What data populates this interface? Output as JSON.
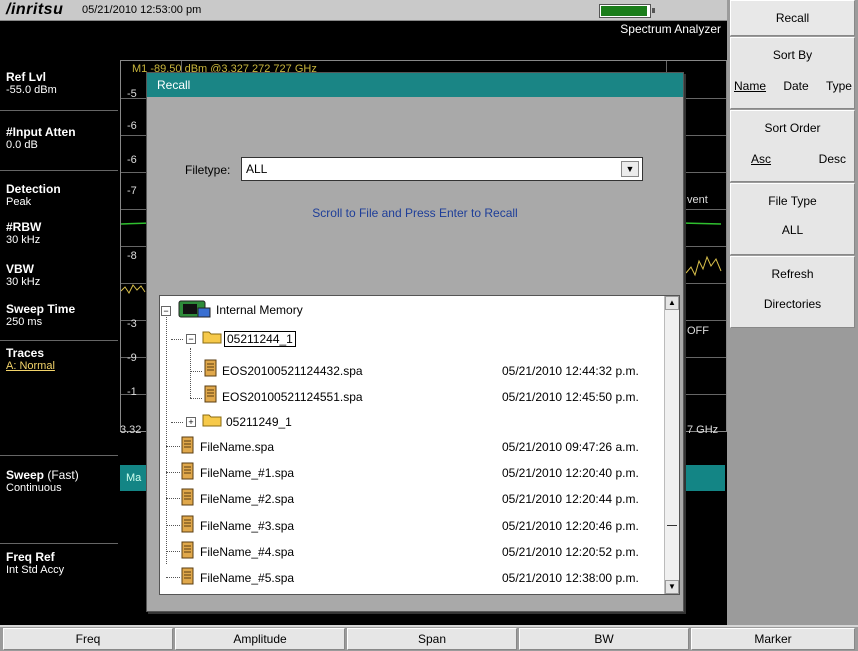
{
  "status": {
    "logo": "/inritsu",
    "datetime": "05/21/2010 12:53:00 pm",
    "battery_level": 0.95,
    "mode": "Spectrum Analyzer"
  },
  "params": {
    "ref_lvl_label": "Ref Lvl",
    "ref_lvl_value": "-55.0 dBm",
    "input_atten_label": "#Input Atten",
    "input_atten_value": "0.0 dB",
    "detection_label": "Detection",
    "detection_value": "Peak",
    "rbw_label": "#RBW",
    "rbw_value": "30 kHz",
    "vbw_label": "VBW",
    "vbw_value": "30 kHz",
    "sweep_time_label": "Sweep Time",
    "sweep_time_value": "250 ms",
    "traces_label": "Traces",
    "traces_value": "A: Normal",
    "sweep_label": "Sweep",
    "sweep_suffix": "(Fast)",
    "sweep_value": "Continuous",
    "freq_ref_label": "Freq Ref",
    "freq_ref_value": "Int Std Accy"
  },
  "plot_peeks": {
    "marker": "M1  -89.50 dBm @3.327 272 727 GHz",
    "ticks": [
      "-5",
      "-6",
      "-6",
      "-7",
      "-8",
      "-3",
      "-9",
      "-1"
    ],
    "event": "vent",
    "off": "OFF",
    "freq_left": "3.32",
    "freq_right": "7 GHz",
    "bar_text": "Ma"
  },
  "dialog": {
    "title": "Recall",
    "filetype_label": "Filetype:",
    "filetype_value": "ALL",
    "instruction": "Scroll to File and Press Enter to Recall",
    "root": "Internal Memory",
    "folder1": "05211244_1",
    "folder1_files": [
      {
        "name": "EOS20100521124432.spa",
        "date": "05/21/2010 12:44:32 p.m."
      },
      {
        "name": "EOS20100521124551.spa",
        "date": "05/21/2010 12:45:50 p.m."
      }
    ],
    "folder2": "05211249_1",
    "files": [
      {
        "name": "FileName.spa",
        "date": "05/21/2010 09:47:26 a.m."
      },
      {
        "name": "FileName_#1.spa",
        "date": "05/21/2010 12:20:40 p.m."
      },
      {
        "name": "FileName_#2.spa",
        "date": "05/21/2010 12:20:44 p.m."
      },
      {
        "name": "FileName_#3.spa",
        "date": "05/21/2010 12:20:46 p.m."
      },
      {
        "name": "FileName_#4.spa",
        "date": "05/21/2010 12:20:52 p.m."
      },
      {
        "name": "FileName_#5.spa",
        "date": "05/21/2010 12:38:00 p.m."
      }
    ]
  },
  "softkeys": {
    "title": "Recall",
    "sort_by_label": "Sort By",
    "sort_by_options": [
      "Name",
      "Date",
      "Type"
    ],
    "sort_order_label": "Sort Order",
    "sort_order_options": [
      "Asc",
      "Desc"
    ],
    "file_type_label": "File Type",
    "file_type_value": "ALL",
    "refresh": "Refresh",
    "directories": "Directories"
  },
  "bottom_menu": [
    "Freq",
    "Amplitude",
    "Span",
    "BW",
    "Marker"
  ],
  "colors": {
    "teal": "#1a8585",
    "link_yellow": "#f3d46a",
    "instruction_blue": "#1e3e99",
    "battery_green": "#1b7d1b"
  }
}
